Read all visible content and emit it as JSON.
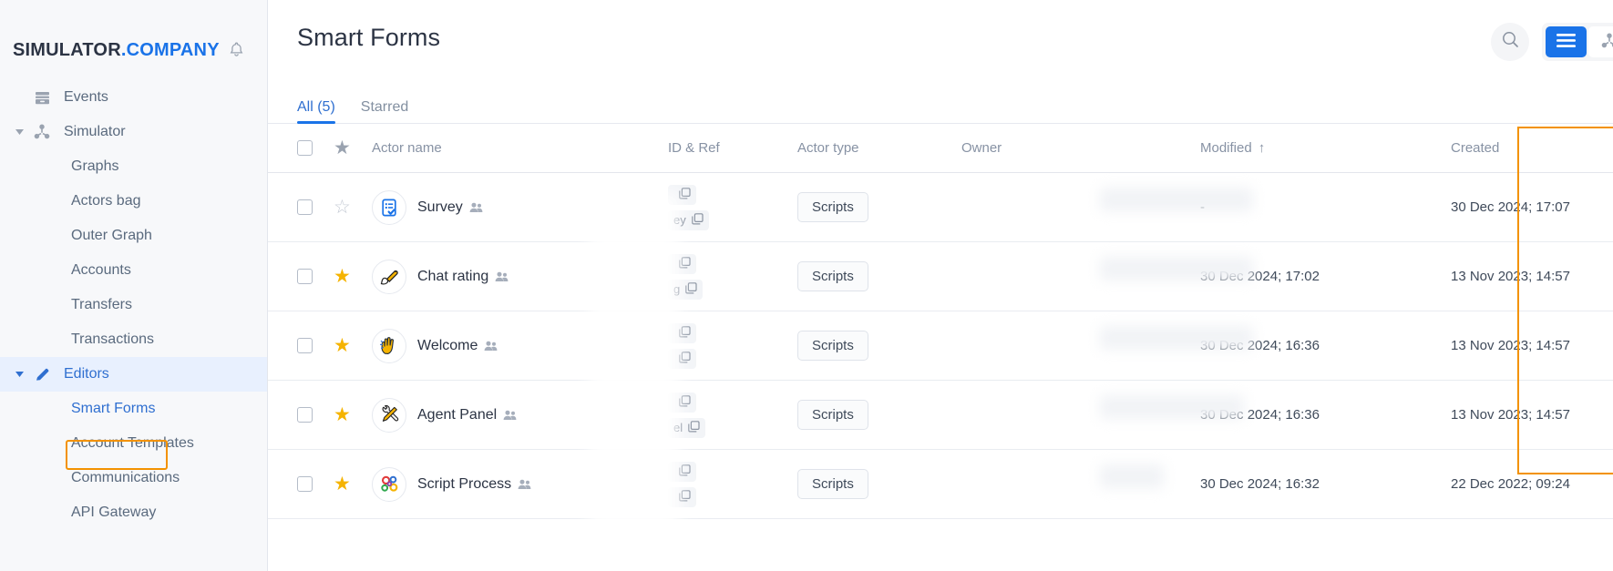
{
  "brand": {
    "name_primary": "SIMULATOR",
    "name_secondary": ".COMPANY",
    "bell_icon": "bell-icon"
  },
  "sidebar": {
    "items": [
      {
        "label": "Events",
        "icon": "archive-icon",
        "level": "top",
        "state": "normal"
      },
      {
        "label": "Simulator",
        "icon": "network-icon",
        "level": "group",
        "state": "expanded"
      },
      {
        "label": "Graphs",
        "icon": "",
        "level": "child",
        "state": "normal"
      },
      {
        "label": "Actors bag",
        "icon": "",
        "level": "child",
        "state": "normal"
      },
      {
        "label": "Outer Graph",
        "icon": "",
        "level": "child",
        "state": "normal"
      },
      {
        "label": "Accounts",
        "icon": "",
        "level": "child",
        "state": "normal"
      },
      {
        "label": "Transfers",
        "icon": "",
        "level": "child",
        "state": "normal"
      },
      {
        "label": "Transactions",
        "icon": "",
        "level": "child",
        "state": "normal"
      },
      {
        "label": "Editors",
        "icon": "pencil-icon",
        "level": "group",
        "state": "expanded-active"
      },
      {
        "label": "Smart Forms",
        "icon": "",
        "level": "child",
        "state": "selected-highlighted"
      },
      {
        "label": "Account Templates",
        "icon": "",
        "level": "child",
        "state": "normal"
      },
      {
        "label": "Communications",
        "icon": "",
        "level": "child",
        "state": "normal"
      },
      {
        "label": "API Gateway",
        "icon": "",
        "level": "child",
        "state": "normal"
      }
    ]
  },
  "header": {
    "title": "Smart Forms",
    "search_icon": "search-icon",
    "view_list_icon": "list-view-icon",
    "view_graph_icon": "graph-view-icon"
  },
  "tabs": [
    {
      "label": "All (5)",
      "active": true
    },
    {
      "label": "Starred",
      "active": false
    }
  ],
  "table": {
    "columns": {
      "actor_name": "Actor name",
      "id_ref": "ID & Ref",
      "actor_type": "Actor type",
      "owner": "Owner",
      "modified": "Modified",
      "modified_sort": "↑",
      "created": "Created"
    },
    "rows": [
      {
        "checked": false,
        "starred": false,
        "star_glyph": "☆",
        "avatar_icon": "survey-form-icon",
        "avatar_glyph": "",
        "name": "Survey",
        "shared_icon": "shared-users-icon",
        "id_chip_1": "",
        "id_chip_2": "ey",
        "actor_type": "Scripts",
        "owner": "",
        "modified": "-",
        "created": "30 Dec 2024; 17:07"
      },
      {
        "checked": false,
        "starred": true,
        "star_glyph": "★",
        "avatar_icon": "paintbrush-icon",
        "avatar_glyph": "🖌",
        "name": "Chat rating",
        "shared_icon": "shared-users-icon",
        "id_chip_1": "",
        "id_chip_2": "g",
        "actor_type": "Scripts",
        "owner": "",
        "modified": "30 Dec 2024; 17:02",
        "created": "13 Nov 2023; 14:57"
      },
      {
        "checked": false,
        "starred": true,
        "star_glyph": "★",
        "avatar_icon": "waving-hand-icon",
        "avatar_glyph": "👋",
        "name": "Welcome",
        "shared_icon": "shared-users-icon",
        "id_chip_1": "",
        "id_chip_2": "",
        "actor_type": "Scripts",
        "owner": "",
        "modified": "30 Dec 2024; 16:36",
        "created": "13 Nov 2023; 14:57"
      },
      {
        "checked": false,
        "starred": true,
        "star_glyph": "★",
        "avatar_icon": "hammer-and-wrench-icon",
        "avatar_glyph": "🛠",
        "name": "Agent Panel",
        "shared_icon": "shared-users-icon",
        "id_chip_1": "",
        "id_chip_2": "el",
        "actor_type": "Scripts",
        "owner": "",
        "modified": "30 Dec 2024; 16:36",
        "created": "13 Nov 2023; 14:57"
      },
      {
        "checked": false,
        "starred": true,
        "star_glyph": "★",
        "avatar_icon": "gears-icon",
        "avatar_glyph": "⚙",
        "name": "Script Process",
        "shared_icon": "shared-users-icon",
        "id_chip_1": "",
        "id_chip_2": "",
        "actor_type": "Scripts",
        "owner": "",
        "modified": "30 Dec 2024; 16:32",
        "created": "22 Dec 2022; 09:24"
      }
    ]
  },
  "annotations": {
    "highlight_color": "#f39200",
    "sidebar_highlight_target": "Smart Forms",
    "column_highlight_target": "Created"
  },
  "colors": {
    "accent_blue": "#1a73e8",
    "link_blue": "#2f6fd0",
    "star_gold": "#f5b301",
    "sidebar_bg": "#f7f8fa",
    "text_dark": "#2c3444",
    "text_muted": "#8792a4"
  }
}
